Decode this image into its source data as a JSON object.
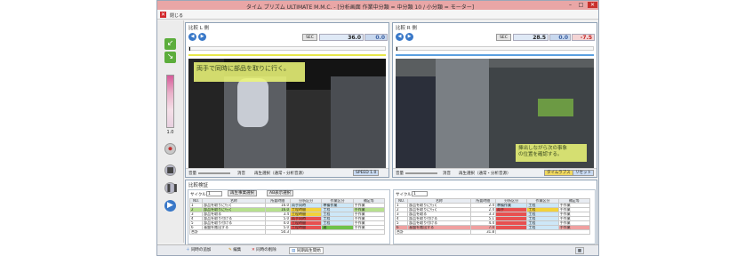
{
  "window": {
    "title": "タイム プリズム ULTIMATE M.M.C. - [分析画面 作業中分類 = 中分類 10 / 小分類 = モーター]",
    "min": "–",
    "max": "□",
    "close": "✕"
  },
  "menu": {
    "close_label": "閉じる"
  },
  "toolbar": {
    "speed_value": "1.0"
  },
  "left_video": {
    "title": "比較 L 側",
    "sec_label": "SEC",
    "time_value": "36.0",
    "sub_value": "0.0",
    "caption": "両手で同時に部品を取りに行く。",
    "volume_label": "音量",
    "mute_label": "消音",
    "playback_label": "再生選択（通常・分析音源）",
    "speed_label": "SPEED 1.0"
  },
  "right_video": {
    "title": "比較 R 側",
    "sec_label": "SEC",
    "time_value": "28.5",
    "sub_value": "0.0",
    "diff_value": "-7.5",
    "caption_line1": "挿出しながら次の事象",
    "caption_line2": "の位置を確認する。",
    "volume_label": "音量",
    "mute_label": "消音",
    "playback_label": "再生選択（通常・分析音源）",
    "timelapse_label": "タイムラプス",
    "reset_label": "リセット"
  },
  "compare": {
    "title": "比較検証",
    "cycle_label": "サイクル",
    "cycle_value": "1",
    "btn_register": "再生事業選択",
    "btn_show": "AB表示選択",
    "headers": [
      "NO.",
      "名称",
      "所要時間",
      "分析区分",
      "作業区分",
      "補足等"
    ],
    "left_rows": [
      [
        "1",
        "部品を取りに行く",
        "16.0",
        "両手同時",
        "準備作業",
        "手作業"
      ],
      [
        "2",
        "部品を取りに行く",
        "16.0",
        "工程時間",
        "工程",
        "手作業"
      ],
      [
        "3",
        "部品を取る",
        "3.4",
        "工程時間",
        "工程",
        "手作業"
      ],
      [
        "4",
        "部品を取り付ける",
        "5.0",
        "両手同時",
        "工程",
        "手作業"
      ],
      [
        "5",
        "部品を取り付ける",
        "4.0",
        "工程時間",
        "工程",
        "手作業"
      ],
      [
        "6",
        "基盤を搬出する",
        "5.0",
        "工程時間",
        "遅",
        "手作業"
      ]
    ],
    "left_total_label": "合計",
    "left_total_value": "50.3",
    "right_rows": [
      [
        "1",
        "部品を取りに行く",
        "2.4",
        "準備作業",
        "工程",
        "手作業"
      ],
      [
        "2",
        "部品を取りに行く",
        "2.4",
        "両手",
        "工程",
        "手作業"
      ],
      [
        "3",
        "部品を取る",
        "3.3",
        "",
        "工程",
        "手作業"
      ],
      [
        "4",
        "部品を取り付ける",
        "5.1",
        "",
        "工程",
        "手作業"
      ],
      [
        "5",
        "部品を取り付ける",
        "4.4",
        "",
        "工程",
        "手作業"
      ],
      [
        "6",
        "基盤を搬出する",
        "7.0",
        "",
        "工程",
        "手作業"
      ]
    ],
    "right_total_label": "合計",
    "right_total_value": "31.8"
  },
  "statusbar": {
    "add_label": "同時の追加",
    "edit_label": "編集",
    "delete_label": "同時の削除",
    "sync_label": "同期再生開始"
  },
  "colors": {
    "titlebar": "#e9a6a6",
    "accent": "#3978c8",
    "caption": "#ebf578",
    "row_highlight": "#b7e08f",
    "row_red": "#e85050"
  }
}
